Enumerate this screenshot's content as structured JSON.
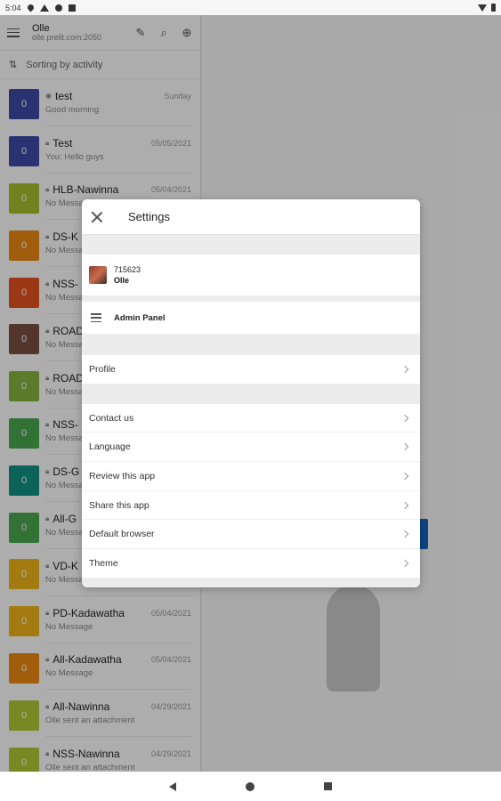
{
  "status_bar": {
    "time": "5:04"
  },
  "header": {
    "account_name": "Olle",
    "server_url": "olle.prelit.com:2050"
  },
  "sort": {
    "label": "Sorting by activity"
  },
  "chats": [
    {
      "title": "test",
      "date": "Sunday",
      "preview": "Good morning",
      "avatar_text": "0",
      "color": "#3f4aa8",
      "locked": false
    },
    {
      "title": "Test",
      "date": "05/05/2021",
      "preview": "You: Hello guys",
      "avatar_text": "0",
      "color": "#3f4aa8",
      "locked": true
    },
    {
      "title": "HLB-Nawinna",
      "date": "05/04/2021",
      "preview": "No Message",
      "avatar_text": "0",
      "color": "#a8c02e",
      "locked": true
    },
    {
      "title": "DS-K",
      "date": "",
      "preview": "No Messa",
      "avatar_text": "0",
      "color": "#ec8a12",
      "locked": true
    },
    {
      "title": "NSS-",
      "date": "",
      "preview": "No Messa",
      "avatar_text": "0",
      "color": "#e5521f",
      "locked": true
    },
    {
      "title": "ROAD",
      "date": "",
      "preview": "No Messa",
      "avatar_text": "0",
      "color": "#7a5040",
      "locked": true
    },
    {
      "title": "ROAD",
      "date": "",
      "preview": "No Messa",
      "avatar_text": "0",
      "color": "#86b53e",
      "locked": true
    },
    {
      "title": "NSS-",
      "date": "",
      "preview": "No Messa",
      "avatar_text": "0",
      "color": "#4aa84e",
      "locked": true
    },
    {
      "title": "DS-G",
      "date": "",
      "preview": "No Messa",
      "avatar_text": "0",
      "color": "#139384",
      "locked": true
    },
    {
      "title": "All-G",
      "date": "",
      "preview": "No Messa",
      "avatar_text": "0",
      "color": "#4aa84e",
      "locked": true
    },
    {
      "title": "VD-K",
      "date": "",
      "preview": "No Messa",
      "avatar_text": "0",
      "color": "#f0b619",
      "locked": true
    },
    {
      "title": "PD-Kadawatha",
      "date": "05/04/2021",
      "preview": "No Message",
      "avatar_text": "0",
      "color": "#f0b619",
      "locked": true
    },
    {
      "title": "All-Kadawatha",
      "date": "05/04/2021",
      "preview": "No Message",
      "avatar_text": "0",
      "color": "#ec8a12",
      "locked": true
    },
    {
      "title": "All-Nawinna",
      "date": "04/29/2021",
      "preview": "Olle sent an attachment",
      "avatar_text": "0",
      "color": "#b2c934",
      "locked": true
    },
    {
      "title": "NSS-Nawinna",
      "date": "04/29/2021",
      "preview": "Olle sent an attachment",
      "avatar_text": "0",
      "color": "#b2c934",
      "locked": true
    }
  ],
  "settings": {
    "title": "Settings",
    "account": {
      "user_id": "715623",
      "name": "Olle"
    },
    "admin_panel": "Admin Panel",
    "profile": "Profile",
    "menu": [
      "Contact us",
      "Language",
      "Review this app",
      "Share this app",
      "Default browser",
      "Theme"
    ]
  }
}
